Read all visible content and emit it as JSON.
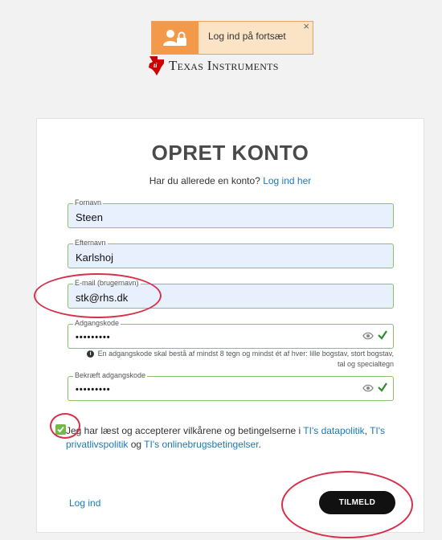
{
  "toast": {
    "message": "Log ind på fortsæt",
    "close_glyph": "×",
    "icon": "user-lock-icon"
  },
  "brand": {
    "first": "Texas",
    "second": "Instruments",
    "logo": "ti-logo"
  },
  "form": {
    "title": "OPRET KONTO",
    "subtitle_text": "Har du allerede en konto?",
    "subtitle_link": "Log ind her",
    "fields": {
      "first_name": {
        "label": "Fornavn",
        "value": "Steen"
      },
      "last_name": {
        "label": "Efternavn",
        "value": "Karlshoj"
      },
      "email": {
        "label": "E-mail (brugernavn)",
        "value": "stk@rhs.dk"
      },
      "password": {
        "label": "Adgangskode",
        "value": "•••••••••"
      },
      "confirm_password": {
        "label": "Bekræft adgangskode",
        "value": "•••••••••"
      }
    },
    "password_hint": "En adgangskode skal bestå af mindst 8 tegn og mindst ét af hver: lille bogstav, stort bogstav, tal og specialtegn",
    "agree": {
      "checked": true,
      "text_before": "Jeg har læst og accepterer vilkårene og betingelserne i ",
      "link1": "TI's datapolitik",
      "sep1": ", ",
      "link2": "TI's privatlivspolitik",
      "sep2": " og ",
      "link3": "TI's onlinebrugsbetingelser",
      "end": "."
    },
    "login_link": "Log ind",
    "submit_label": "TILMELD"
  },
  "colors": {
    "accent": "#1a7ab8",
    "valid_border": "#8cc06a",
    "annotation": "#d6304a",
    "toast_bg": "#fbe3c6",
    "toast_icon_bg": "#f29a4a",
    "ti_red": "#cc0000"
  }
}
